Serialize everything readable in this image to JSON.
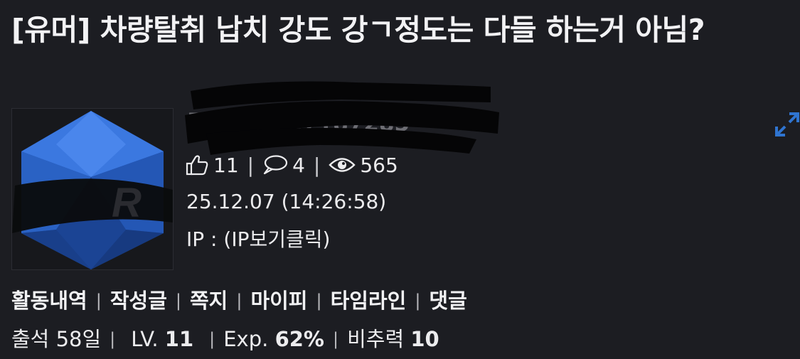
{
  "post": {
    "title": "[유머] 차량탈취 납치 강도 강ㄱ정도는 다들 하는거 아님?"
  },
  "author": {
    "username": "루리웹-8017187285",
    "likes": "11",
    "comments": "4",
    "views": "565",
    "datetime": "25.12.07 (14:26:58)",
    "ip_prefix": "IP : ",
    "ip_link": "(IP보기클릭)"
  },
  "menu": {
    "activity": "활동내역",
    "posts": "작성글",
    "message": "쪽지",
    "mypi": "마이피",
    "timeline": "타임라인",
    "comments": "댓글"
  },
  "profile": {
    "attendance_label": "출석 58일",
    "level_label": "LV.",
    "level_value": "11",
    "exp_label": "Exp.",
    "exp_value": "62%",
    "ratio_label": "비추력",
    "ratio_value": "10"
  },
  "colors": {
    "background": "#1c1d22",
    "accent_blue": "#2f74d0",
    "text": "#ececee"
  },
  "icons": {
    "like": "thumbs-up-icon",
    "comment": "speech-bubble-icon",
    "view": "eye-icon",
    "expand": "expand-arrows-icon"
  }
}
